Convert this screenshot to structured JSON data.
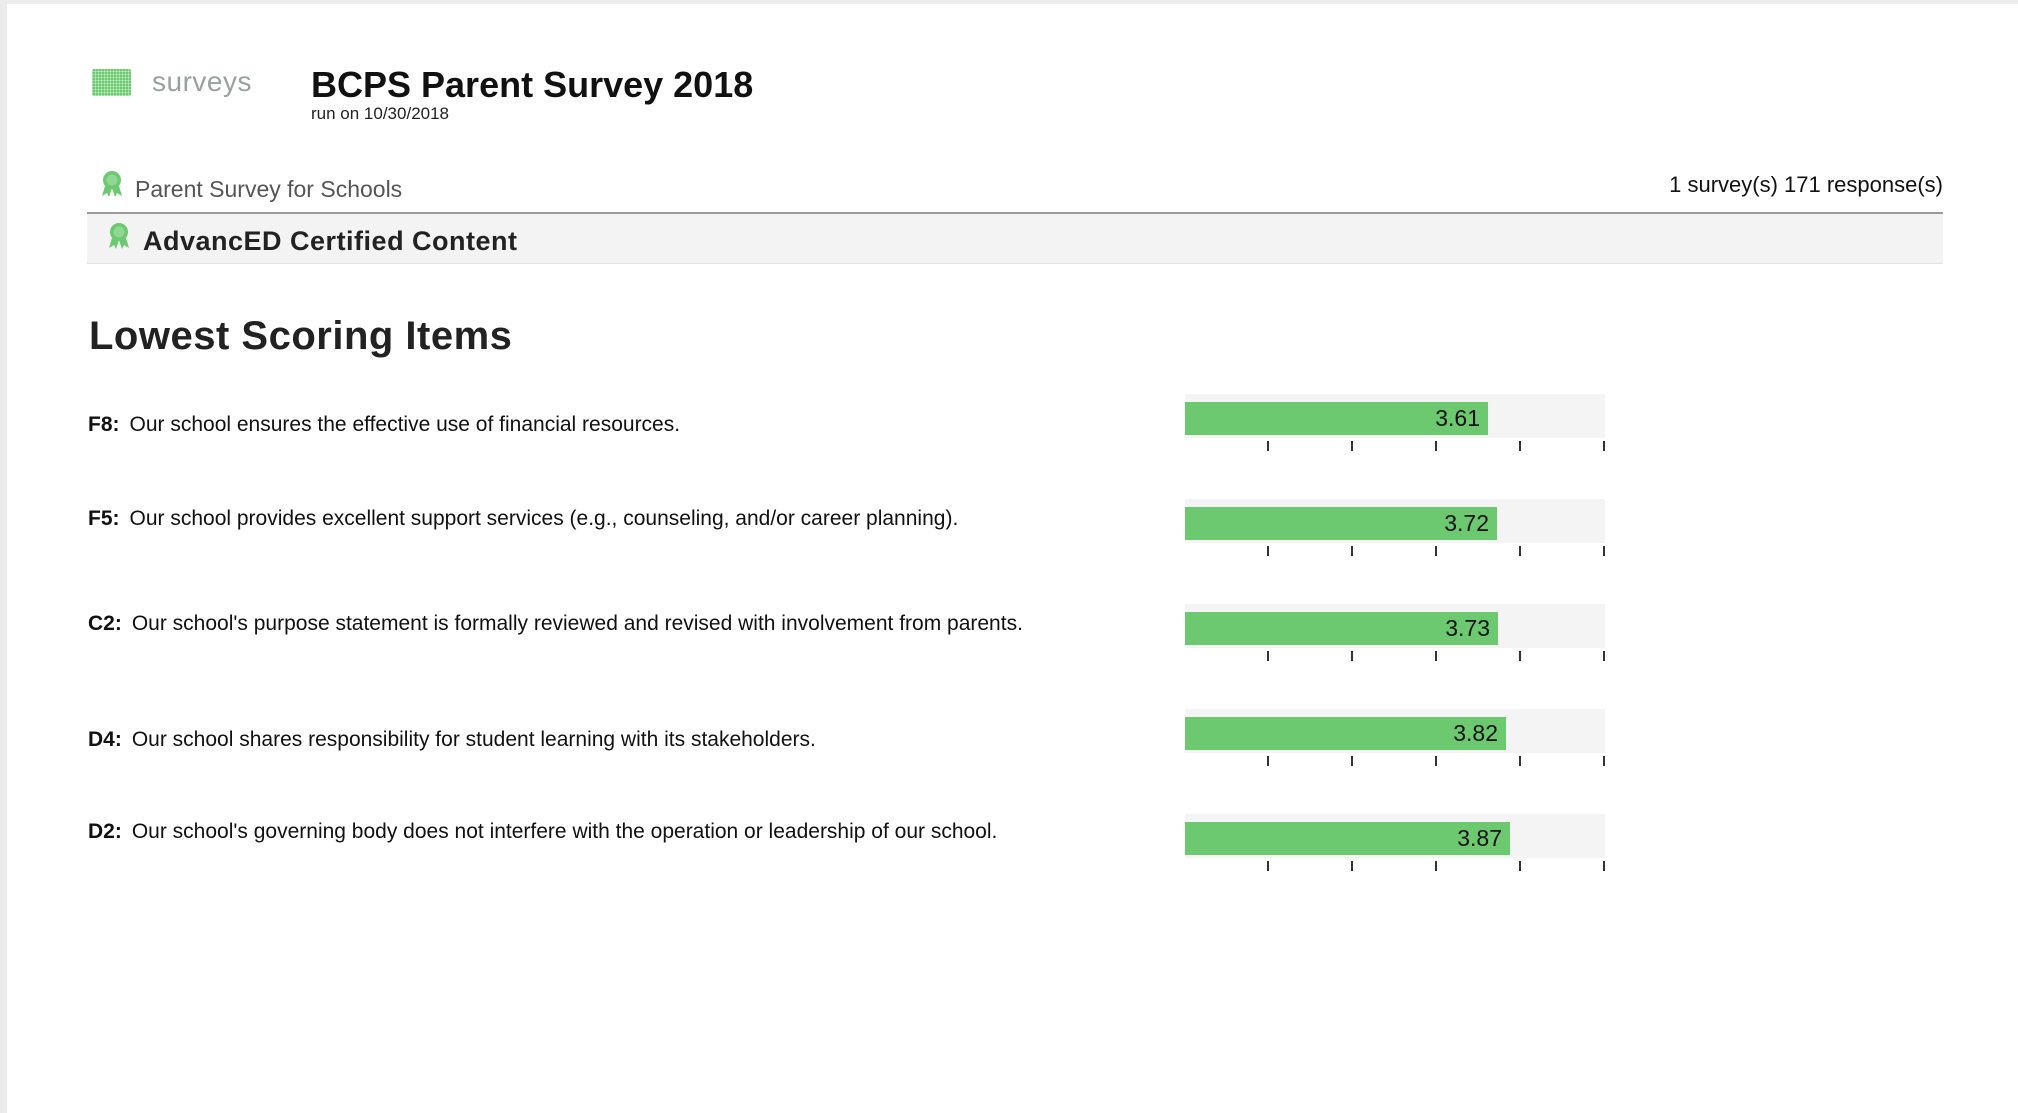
{
  "header": {
    "logo_text": "surveys",
    "title": "BCPS Parent Survey 2018",
    "run_on": "run on 10/30/2018"
  },
  "survey": {
    "name": "Parent Survey for Schools",
    "stats": "1 survey(s)  171 response(s)"
  },
  "certification": {
    "label": "AdvancED Certified Content"
  },
  "section": {
    "heading": "Lowest Scoring Items"
  },
  "colors": {
    "accent_green": "#6cc96f"
  },
  "chart_data": {
    "type": "bar",
    "orientation": "horizontal",
    "xlim": [
      0,
      5
    ],
    "categories": [
      "F8",
      "F5",
      "C2",
      "D4",
      "D2"
    ],
    "values": [
      3.61,
      3.72,
      3.73,
      3.82,
      3.87
    ]
  },
  "items": [
    {
      "code": "F8:",
      "text": "Our school ensures the effective use of financial resources.",
      "score": 3.61,
      "score_label": "3.61"
    },
    {
      "code": "F5:",
      "text": "Our school provides excellent support services (e.g., counseling, and/or career planning).",
      "score": 3.72,
      "score_label": "3.72"
    },
    {
      "code": "C2:",
      "text": "Our school's purpose statement is formally reviewed and revised with involvement from parents.",
      "score": 3.73,
      "score_label": "3.73"
    },
    {
      "code": "D4:",
      "text": "Our school shares responsibility for student learning with its stakeholders.",
      "score": 3.82,
      "score_label": "3.82"
    },
    {
      "code": "D2:",
      "text": "Our school's governing body does not interfere with the operation or leadership of our school.",
      "score": 3.87,
      "score_label": "3.87"
    }
  ]
}
